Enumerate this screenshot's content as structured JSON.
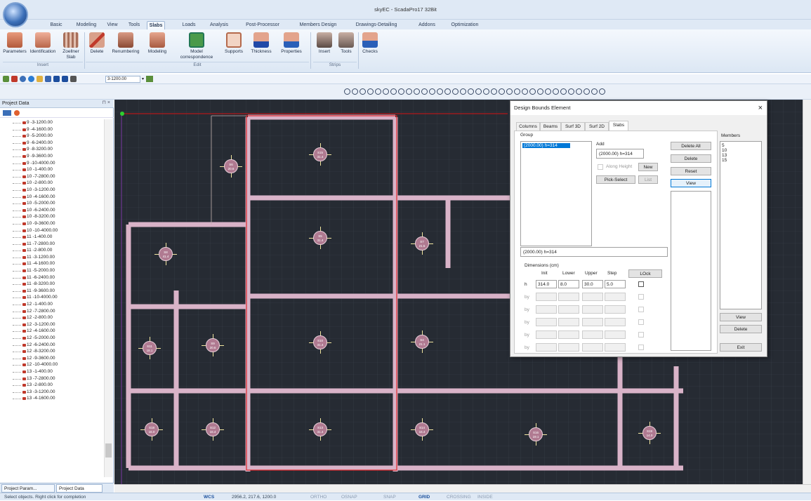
{
  "window": {
    "title": "skyEC - ScadaPro17 32Bit"
  },
  "menu_tabs": [
    "Basic",
    "Modeling",
    "View",
    "Tools",
    "Slabs",
    "Loads",
    "Analysis",
    "Post-Processor",
    "Members Design",
    "Drawings-Detailing",
    "Addons",
    "Optimization"
  ],
  "active_tab": "Slabs",
  "ribbon": {
    "buttons": [
      {
        "label": "Parameters",
        "icon": "slab-parameters-icon"
      },
      {
        "label": "Identification",
        "icon": "slab-identification-icon"
      },
      {
        "label": "Zoellner Slab",
        "icon": "zoellner-slab-icon"
      },
      {
        "label": "Delete",
        "icon": "slab-delete-icon"
      },
      {
        "label": "Renumbering",
        "icon": "slab-renumbering-icon"
      },
      {
        "label": "Modeling",
        "icon": "slab-modeling-icon"
      },
      {
        "label": "Model correspondence",
        "icon": "model-correspondence-icon"
      },
      {
        "label": "Supports",
        "icon": "slab-supports-icon"
      },
      {
        "label": "Thickness",
        "icon": "slab-thickness-icon"
      },
      {
        "label": "Properties",
        "icon": "slab-properties-icon"
      },
      {
        "label": "Insert",
        "icon": "strip-insert-icon"
      },
      {
        "label": "Tools",
        "icon": "strip-tools-icon"
      },
      {
        "label": "Checks",
        "icon": "checks-icon"
      }
    ],
    "groups": [
      "Insert",
      "Edit",
      "Strips"
    ]
  },
  "quick_access": {
    "level_combo": "3-1200.00"
  },
  "project_panel": {
    "title": "Project Data",
    "pin": "X ×",
    "items": [
      "9 -3-1200.00",
      "9 -4-1600.00",
      "9 -5-2000.00",
      "9 -6-2400.00",
      "9 -8-3200.00",
      "9 -9-3600.00",
      "9 -10-4000.00",
      "10 -1-400.00",
      "10 -7-2800.00",
      "10 -2-800.00",
      "10 -3-1200.00",
      "10 -4-1600.00",
      "10 -5-2000.00",
      "10 -6-2400.00",
      "10 -8-3200.00",
      "10 -9-3600.00",
      "10 -10-4000.00",
      "11 -1-400.00",
      "11 -7-2800.00",
      "11 -2-800.00",
      "11 -3-1200.00",
      "11 -4-1600.00",
      "11 -5-2000.00",
      "11 -6-2400.00",
      "11 -8-3200.00",
      "11 -9-3600.00",
      "11 -10-4000.00",
      "12 -1-400.00",
      "12 -7-2800.00",
      "12 -2-800.00",
      "12 -3-1200.00",
      "12 -4-1600.00",
      "12 -5-2000.00",
      "12 -6-2400.00",
      "12 -8-3200.00",
      "12 -9-3600.00",
      "12 -10-4000.00",
      "13 -1-400.00",
      "13 -7-2800.00",
      "13 -2-800.00",
      "13 -3-1200.00",
      "13 -4-1600.00"
    ],
    "tabs": [
      "Project Param...",
      "Project Data"
    ]
  },
  "slabs": [
    {
      "name": "S15",
      "value": "31.4"
    },
    {
      "name": "S6",
      "value": "20.6"
    },
    {
      "name": "S5",
      "value": "31.4"
    },
    {
      "name": "S7",
      "value": "21.5"
    },
    {
      "name": "S8",
      "value": "41.4"
    },
    {
      "name": "S11",
      "value": "18.1"
    },
    {
      "name": "S9",
      "value": "20.6"
    },
    {
      "name": "S10",
      "value": "31.4"
    },
    {
      "name": "S4",
      "value": "21.1"
    },
    {
      "name": "S18",
      "value": "16.0"
    },
    {
      "name": "S12",
      "value": "16.4"
    },
    {
      "name": "S13",
      "value": "31.4"
    },
    {
      "name": "S14",
      "value": "16.4"
    },
    {
      "name": "S16",
      "value": "19.1"
    },
    {
      "name": "S19",
      "value": "14.0"
    }
  ],
  "dialog": {
    "title": "Design Bounds Element",
    "close": "×",
    "tabs": [
      "Columns",
      "Beams",
      "Surf 3D",
      "Surf 2D",
      "Slabs"
    ],
    "active_tab": "Slabs",
    "group_label": "Group",
    "group_items": [
      "(2000.00) h=314"
    ],
    "add_label": "Add",
    "add_value": "(2000.00) h=314",
    "along_height": "Along Height",
    "new_btn": "New",
    "pick_select": "Pick-Select",
    "list_btn": "List",
    "delete_all": "Delete All",
    "delete": "Delete",
    "reset": "Reset",
    "view": "View",
    "name_field": "(2000.00) h=314",
    "dimensions_label": "Dimensions (cm)",
    "col_headers": [
      "Init",
      "Lower",
      "Upper",
      "Step",
      "LOck"
    ],
    "row_labels": [
      "h",
      "by",
      "by",
      "by",
      "by",
      "by"
    ],
    "h_values": [
      "314.0",
      "8.0",
      "30.0",
      "5.0"
    ],
    "members_label": "Members",
    "members": [
      "5",
      "10",
      "13",
      "15"
    ],
    "members_view": "View",
    "members_delete": "Delete",
    "exit": "Exit"
  },
  "status": {
    "prompt": "Select objects. Right click for completion",
    "coord_system": "WCS",
    "coords": "2956.2, 217.6, 1200.0",
    "modes": [
      "ORTHO",
      "OSNAP",
      "SNAP",
      "GRID",
      "CROSSING",
      "INSIDE"
    ],
    "active_mode": "GRID"
  },
  "colors": {
    "canvas": "#262b33",
    "beam": "#d9b3c8",
    "selected": "#e0282c",
    "slab_marker": "#b07a91",
    "accent": "#1a4f9c"
  }
}
